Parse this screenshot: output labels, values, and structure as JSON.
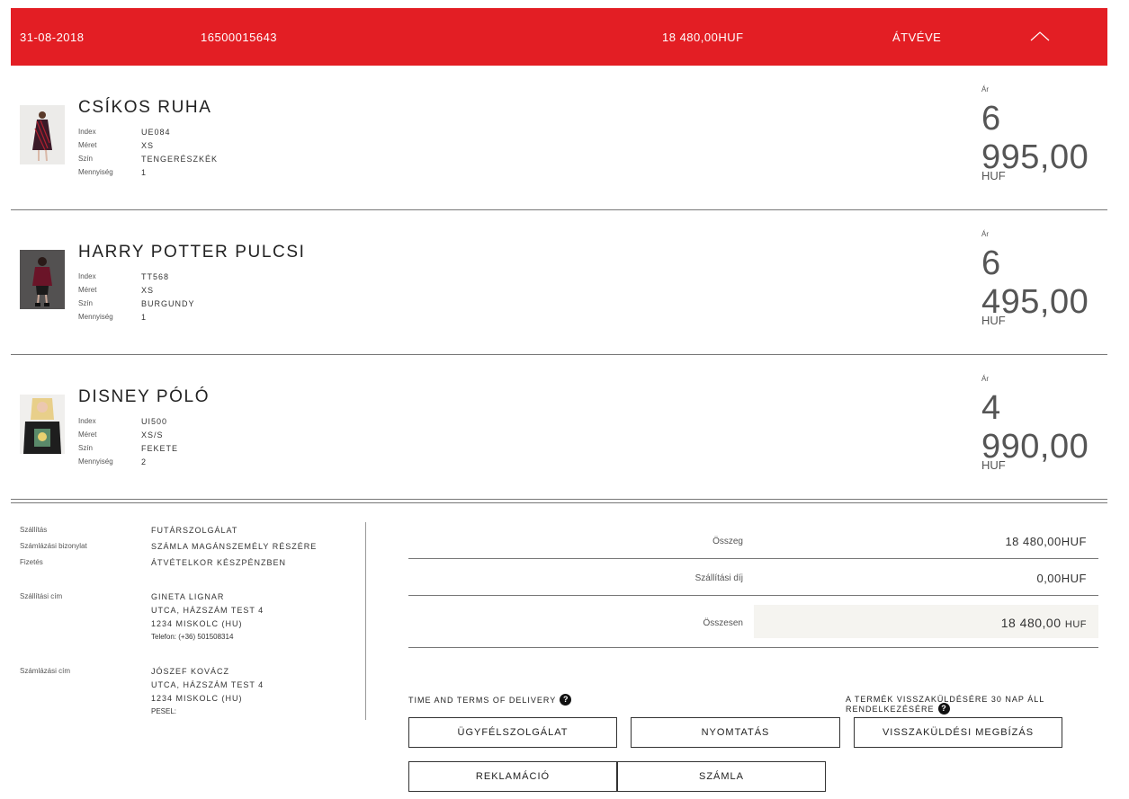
{
  "order": {
    "date": "31-08-2018",
    "number": "16500015643",
    "total": "18 480,00HUF",
    "status": "ÁTVÉVE"
  },
  "attr_labels": {
    "index": "Index",
    "size": "Méret",
    "color": "Szín",
    "quantity": "Mennyiség"
  },
  "price_label": "Ár",
  "products": [
    {
      "name": "CSÍKOS RUHA",
      "index": "UE084",
      "size": "XS",
      "color": "TENGERÉSZKÉK",
      "quantity": "1",
      "price": "6 995,00",
      "currency": "HUF"
    },
    {
      "name": "HARRY POTTER PULCSI",
      "index": "TT568",
      "size": "XS",
      "color": "BURGUNDY",
      "quantity": "1",
      "price": "6 495,00",
      "currency": "HUF"
    },
    {
      "name": "DISNEY PÓLÓ",
      "index": "UI500",
      "size": "XS/S",
      "color": "FEKETE",
      "quantity": "2",
      "price": "4 990,00",
      "currency": "HUF"
    }
  ],
  "delivery": {
    "shipping_label": "Szállítás",
    "shipping_value": "FUTÁRSZOLGÁLAT",
    "invoice_doc_label": "Számlázási bizonylat",
    "invoice_doc_value": "SZÁMLA MAGÁNSZEMÉLY RÉSZÉRE",
    "payment_label": "Fizetés",
    "payment_value": "ÁTVÉTELKOR KÉSZPÉNZBEN",
    "shipping_address_label": "Szállítási cím",
    "shipping_address": {
      "name": "GINETA LIGNAR",
      "street": "UTCA, HÁZSZÁM TEST 4",
      "city": "1234 MISKOLC (HU)",
      "phone": "Telefon: (+36) 501508314"
    },
    "billing_address_label": "Számlázási cím",
    "billing_address": {
      "name": "JÓSZEF KOVÁCZ",
      "street": "UTCA, HÁZSZÁM TEST 4",
      "city": "1234 MISKOLC (HU)",
      "pesel": "PESEL:"
    }
  },
  "summary": {
    "subtotal_label": "Összeg",
    "subtotal_value": "18 480,00HUF",
    "shipping_fee_label": "Szállítási díj",
    "shipping_fee_value": "0,00HUF",
    "total_label": "Összesen",
    "total_value": "18 480,00",
    "total_currency": "HUF"
  },
  "terms": {
    "delivery_terms": "TIME AND TERMS OF DELIVERY",
    "return_note": "A TERMÉK VISSZAKÜLDÉSÉRE 30 NAP ÁLL RENDELKEZÉSÉRE",
    "help_glyph": "?"
  },
  "buttons": {
    "customer_service": "ÜGYFÉLSZOLGÁLAT",
    "print": "NYOMTATÁS",
    "return_order": "VISSZAKÜLDÉSI MEGBÍZÁS",
    "complaint": "REKLAMÁCIÓ",
    "invoice": "SZÁMLA"
  },
  "colors": {
    "header_bg": "#e31e24",
    "total_box_bg": "#f5f4f0"
  },
  "icons": [
    "chevron-up-icon",
    "help-icon"
  ]
}
